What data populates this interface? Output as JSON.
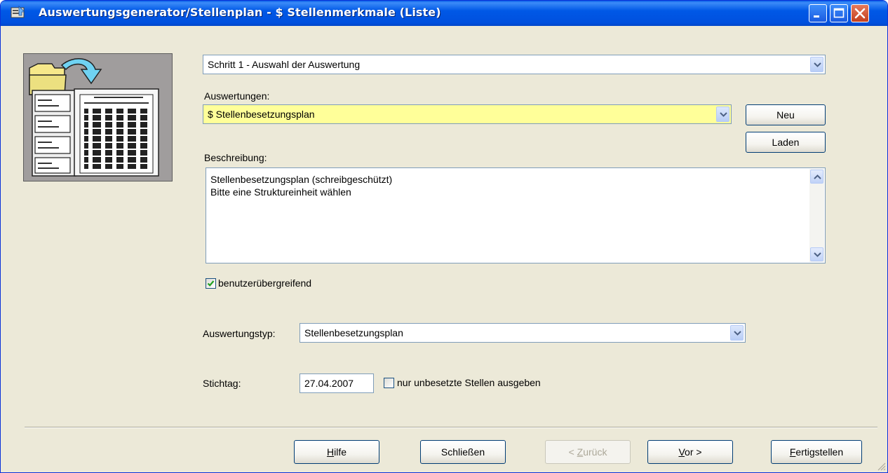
{
  "window": {
    "title": "Auswertungsgenerator/Stellenplan  -  $ Stellenmerkmale (Liste)",
    "controls": [
      "minimize-icon",
      "maximize-icon",
      "close-icon"
    ]
  },
  "wizard": {
    "step": "Schritt 1  -  Auswahl der Auswertung"
  },
  "auswertungen": {
    "label": "Auswertungen:",
    "value": "$ Stellenbesetzungsplan",
    "highlight": "#ffff99"
  },
  "buttons": {
    "neu": "Neu",
    "laden": "Laden"
  },
  "beschreibung": {
    "label": "Beschreibung:",
    "lines": [
      "Stellenbesetzungsplan (schreibgeschützt)",
      "Bitte eine Struktureinheit wählen"
    ]
  },
  "benutzer": {
    "label": "benutzerübergreifend",
    "checked": true
  },
  "typ": {
    "label": "Auswertungstyp:",
    "value": "Stellenbesetzungsplan"
  },
  "stichtag": {
    "label": "Stichtag:",
    "value": "27.04.2007"
  },
  "unbesetzt": {
    "label": "nur unbesetzte Stellen ausgeben",
    "checked": false
  },
  "footer": {
    "hilfe_u": "H",
    "hilfe_rest": "ilfe",
    "schliessen": "Schließen",
    "zurueck_pre": "< ",
    "zurueck_u": "Z",
    "zurueck_rest": "urück",
    "vor_u": "V",
    "vor_rest": "or >",
    "fertig_u": "F",
    "fertig_rest": "ertigstellen"
  }
}
